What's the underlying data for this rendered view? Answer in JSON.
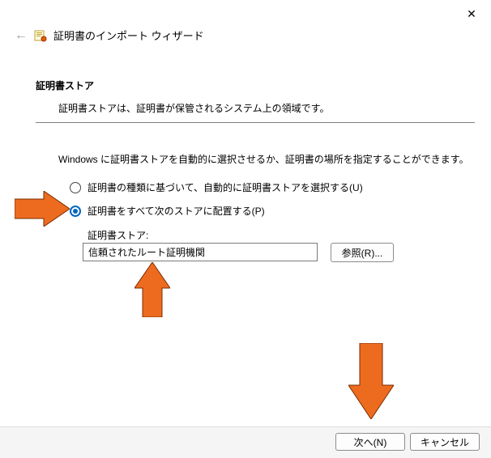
{
  "window": {
    "title": "証明書のインポート ウィザード"
  },
  "section": {
    "heading": "証明書ストア",
    "intro": "証明書ストアは、証明書が保管されるシステム上の領域です。",
    "instruction": "Windows に証明書ストアを自動的に選択させるか、証明書の場所を指定することができます。"
  },
  "options": {
    "auto": "証明書の種類に基づいて、自動的に証明書ストアを選択する(U)",
    "manual": "証明書をすべて次のストアに配置する(P)",
    "store_label": "証明書ストア:",
    "store_value": "信頼されたルート証明機関",
    "browse": "参照(R)..."
  },
  "footer": {
    "next": "次へ(N)",
    "cancel": "キャンセル"
  }
}
